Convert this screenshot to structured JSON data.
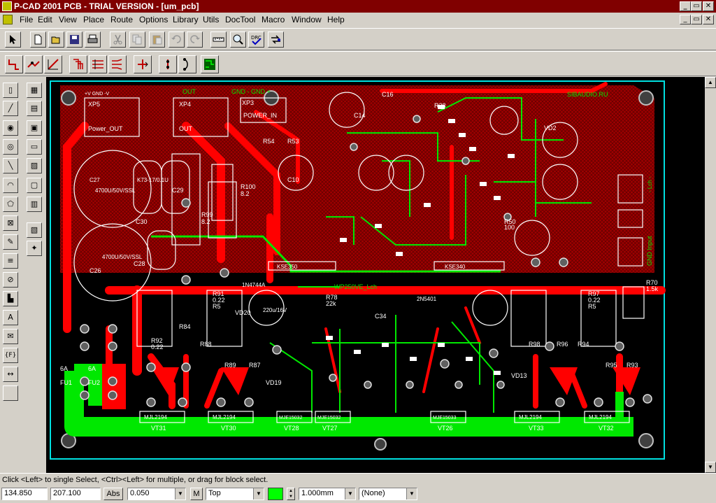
{
  "window": {
    "title": "P-CAD 2001 PCB - TRIAL VERSION  - [um_pcb]",
    "min_glyph": "_",
    "max_glyph": "▭",
    "close_glyph": "✕"
  },
  "menu": [
    {
      "label": "File"
    },
    {
      "label": "Edit"
    },
    {
      "label": "View"
    },
    {
      "label": "Place"
    },
    {
      "label": "Route"
    },
    {
      "label": "Options"
    },
    {
      "label": "Library"
    },
    {
      "label": "Utils"
    },
    {
      "label": "DocTool"
    },
    {
      "label": "Macro"
    },
    {
      "label": "Window"
    },
    {
      "label": "Help"
    }
  ],
  "toolbar1": [
    "select-arrow-icon",
    "new-file-icon",
    "open-file-icon",
    "save-icon",
    "print-icon",
    "cut-icon",
    "copy-icon",
    "paste-icon",
    "undo-icon",
    "redo-icon",
    "measure-icon",
    "zoom-icon",
    "drc-icon",
    "swap-icon"
  ],
  "toolbar2": [
    "route-manual-icon",
    "route-interactive-icon",
    "route-miter-icon",
    "route-multi-icon",
    "route-bus-icon",
    "route-fanout-icon",
    "bus-icon",
    "push-icon",
    "jump-icon",
    "autoroute-icon"
  ],
  "left_tools": [
    {
      "name": "place-component-icon",
      "glyph": "▯"
    },
    {
      "name": "grid-icon",
      "glyph": "▦"
    },
    {
      "name": "place-connection-icon",
      "glyph": "╱"
    },
    {
      "name": "place-pad-icon",
      "glyph": "▤"
    },
    {
      "name": "place-via-icon",
      "glyph": "◉"
    },
    {
      "name": "place-field-icon",
      "glyph": "▣"
    },
    {
      "name": "place-via-alt-icon",
      "glyph": "◎"
    },
    {
      "name": "place-polygon-icon",
      "glyph": "▭"
    },
    {
      "name": "place-line-icon",
      "glyph": "╲"
    },
    {
      "name": "place-copper-icon",
      "glyph": "▨"
    },
    {
      "name": "place-arc-icon",
      "glyph": "◠"
    },
    {
      "name": "place-keepout-icon",
      "glyph": "▢"
    },
    {
      "name": "place-polygon-outline-icon",
      "glyph": "⬠"
    },
    {
      "name": "place-plane-icon",
      "glyph": "▥"
    },
    {
      "name": "place-cutout-icon",
      "glyph": "⊠"
    },
    {
      "name": "place-split-icon",
      "glyph": "▧"
    },
    {
      "name": "paint-icon",
      "glyph": "✎"
    },
    {
      "name": "point-icon",
      "glyph": "✦"
    },
    {
      "name": "stack-icon",
      "glyph": "≡"
    },
    {
      "name": "no-entry-icon",
      "glyph": "⊘"
    },
    {
      "name": "place-corner-icon",
      "glyph": "▙"
    },
    {
      "name": "place-text-icon",
      "glyph": "A"
    },
    {
      "name": "place-attribute-icon",
      "glyph": "✉"
    },
    {
      "name": "place-field-brace-icon",
      "glyph": "{F}"
    },
    {
      "name": "place-dimension-icon",
      "glyph": "↔"
    }
  ],
  "pcb": {
    "labels": {
      "connector_top": "+V  GND  -V",
      "out_label": "OUT",
      "gnd_label": "GND  -   GND   +",
      "brand": "SIBAUDIO.RU",
      "xp5": "XP5",
      "xp4": "XP4",
      "xp3": "XP3",
      "power_out": "Power_OUT",
      "out": "OUT",
      "power_in": "POWER_IN",
      "c27": "C27",
      "c27_val": "4700U/50V/SSL",
      "c28": "C28",
      "c30": "C30",
      "c29": "C29",
      "k73": "K73-17/0.1U",
      "r100": "R100",
      "r100_val": "8.2",
      "r99": "R99",
      "r99_val": "8.2",
      "c26": "C26",
      "c26_val": "4700U/50V/SSL",
      "c16": "C16",
      "c14": "C14",
      "r54": "R54",
      "r53": "R53",
      "r50": "R50",
      "r50_val": "100",
      "r28": "R28",
      "c10": "C10",
      "vd2": "VD2",
      "kse350": "KSE350",
      "kse340": "KSE340",
      "wp_label": "WP250VE_Lch",
      "r91": "R91",
      "r91_val": "0.22",
      "r91_val2": "R5",
      "r78": "R78",
      "r78_val": "22k",
      "r97": "R97",
      "r97_val": "0.22",
      "r97_val2": "R5",
      "r70": "R70",
      "r70_val": "1.5k",
      "r92": "R92",
      "r92_val": "0.22",
      "r84": "R84",
      "r88": "R88",
      "r89": "R89",
      "r87": "R87",
      "r96": "R96",
      "r94": "R94",
      "r95": "R95",
      "r93": "R93",
      "r98": "R98",
      "fu1": "FU1",
      "fu2": "FU2",
      "a6_1": "6A",
      "a6_2": "6A",
      "vt31": "VT31",
      "vt30": "VT30",
      "vt28": "VT28",
      "vt27": "VT27",
      "vt26": "VT26",
      "vt32": "VT32",
      "vt33": "VT33",
      "mjl2194": "MJL2194",
      "mje15032": "MJE15032",
      "mje15033": "MJE15033",
      "vd19": "VD19",
      "vd13": "VD13",
      "vd20": "VD20",
      "n4744a": "1N4744A",
      "c34": "C34",
      "gnd_input": "GND Input",
      "lch": "- Lch -",
      "c22": "220u/16V",
      "vd3": "2N5401"
    }
  },
  "status": {
    "message": "Click <Left> to single Select, <Ctrl><Left> for multiple, or drag for block select."
  },
  "bottom": {
    "x_coord": "134.850",
    "y_coord": "207.100",
    "abs_label": "Abs",
    "grid_value": "0.050",
    "m_label": "M",
    "layer": "Top",
    "layer_color": "#00ff00",
    "line_width": "1.000mm",
    "none_label": "(None)"
  },
  "colors": {
    "board_red": "#c80000",
    "trace_red": "#ff0000",
    "trace_green": "#00e800",
    "silk": "#ffffff",
    "outline": "#00e0e0"
  }
}
